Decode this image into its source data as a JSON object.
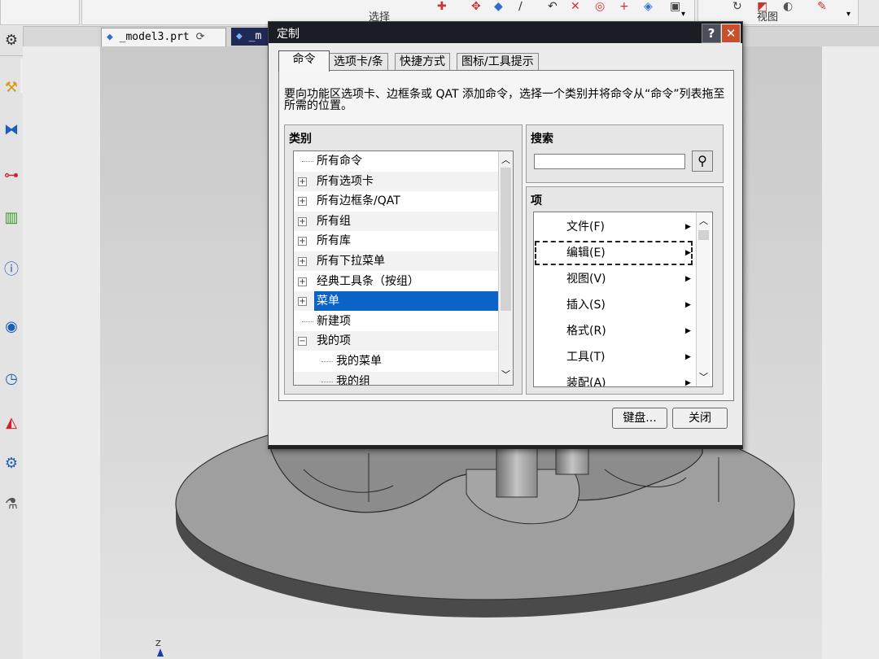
{
  "ribbon": {
    "group_select_label": "选择",
    "group_view_label": "视图"
  },
  "file_tabs": [
    {
      "label": "_model3.prt",
      "mark": "⟳"
    },
    {
      "label": "_m"
    }
  ],
  "dialog": {
    "title": "定制",
    "tabs": [
      "命令",
      "选项卡/条",
      "快捷方式",
      "图标/工具提示"
    ],
    "description": "要向功能区选项卡、边框条或 QAT 添加命令，选择一个类别并将命令从“命令”列表拖至所需的位置。",
    "categories_header": "类别",
    "categories": [
      {
        "label": "所有命令",
        "expandable": false,
        "indent": 0
      },
      {
        "label": "所有选项卡",
        "expandable": true,
        "indent": 0
      },
      {
        "label": "所有边框条/QAT",
        "expandable": true,
        "indent": 0
      },
      {
        "label": "所有组",
        "expandable": true,
        "indent": 0
      },
      {
        "label": "所有库",
        "expandable": true,
        "indent": 0
      },
      {
        "label": "所有下拉菜单",
        "expandable": true,
        "indent": 0
      },
      {
        "label": "经典工具条（按组）",
        "expandable": true,
        "indent": 0
      },
      {
        "label": "菜单",
        "expandable": true,
        "indent": 0,
        "selected": true
      },
      {
        "label": "新建项",
        "expandable": false,
        "indent": 0
      },
      {
        "label": "我的项",
        "expandable": true,
        "expanded": true,
        "indent": 0
      },
      {
        "label": "我的菜单",
        "expandable": false,
        "indent": 1
      },
      {
        "label": "我的组",
        "expandable": false,
        "indent": 1
      }
    ],
    "search_header": "搜索",
    "search_value": "",
    "items_header": "项",
    "items": [
      {
        "label": "文件(F)"
      },
      {
        "label": "编辑(E)",
        "focused": true
      },
      {
        "label": "视图(V)"
      },
      {
        "label": "插入(S)"
      },
      {
        "label": "格式(R)"
      },
      {
        "label": "工具(T)"
      },
      {
        "label": "装配(A)"
      }
    ],
    "keyboard_button": "键盘...",
    "close_button": "关闭"
  },
  "viewport": {
    "axis_label": "Z"
  },
  "colors": {
    "selection": "#0a64c8",
    "titlebar": "#1a1d24",
    "close": "#c9502c"
  }
}
